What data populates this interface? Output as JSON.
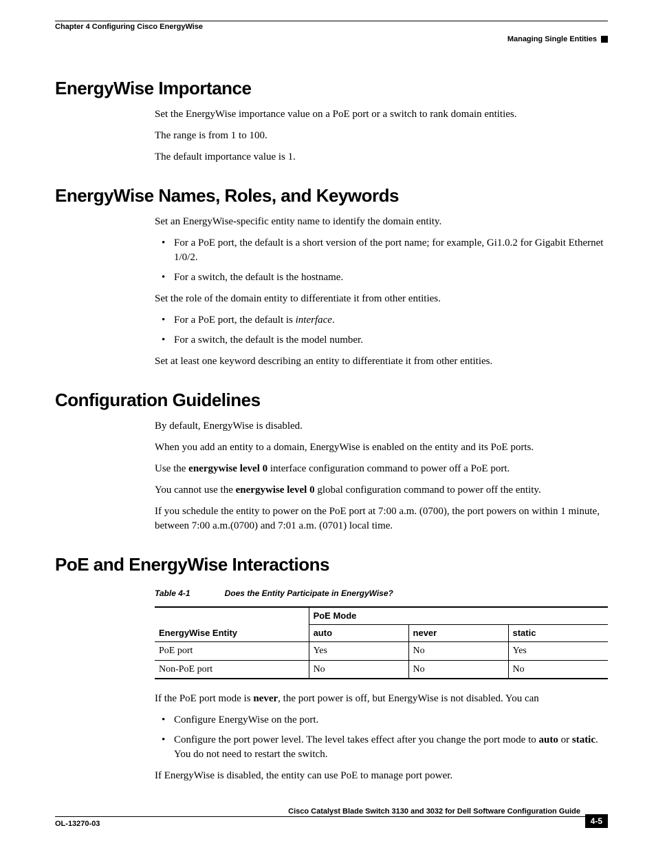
{
  "header": {
    "chapter": "Chapter 4    Configuring Cisco EnergyWise",
    "section_right": "Managing Single Entities"
  },
  "s1": {
    "title": "EnergyWise Importance",
    "p1": "Set the EnergyWise importance value on a PoE port or a switch to rank domain entities.",
    "p2": "The range is from 1 to 100.",
    "p3": "The default importance value is 1."
  },
  "s2": {
    "title": "EnergyWise Names, Roles, and Keywords",
    "p1": "Set an EnergyWise-specific entity name to identify the domain entity.",
    "b1": "For a PoE port, the default is a short version of the port name; for example, Gi1.0.2 for Gigabit Ethernet 1/0/2.",
    "b2": "For a switch, the default is the hostname.",
    "p2": "Set the role of the domain entity to differentiate it from other entities.",
    "b3_pre": "For a PoE port, the default is ",
    "b3_it": "interface",
    "b3_post": ".",
    "b4": "For a switch, the default is the model number.",
    "p3": "Set at least one keyword describing an entity to differentiate it from other entities."
  },
  "s3": {
    "title": "Configuration Guidelines",
    "p1": "By default, EnergyWise is disabled.",
    "p2": "When you add an entity to a domain, EnergyWise is enabled on the entity and its PoE ports.",
    "p3_a": "Use the ",
    "p3_b": "energywise level 0",
    "p3_c": " interface configuration command to power off a PoE port.",
    "p4_a": "You cannot use the ",
    "p4_b": "energywise level 0",
    "p4_c": " global configuration command to power off the entity.",
    "p5": "If you schedule the entity to power on the PoE port at 7:00 a.m. (0700), the port powers on within 1 minute, between 7:00 a.m.(0700) and 7:01 a.m. (0701) local time."
  },
  "s4": {
    "title": "PoE and EnergyWise Interactions",
    "table_num": "Table 4-1",
    "table_title": "Does the Entity Participate in EnergyWise?",
    "th_entity": "EnergyWise Entity",
    "th_mode": "PoE Mode",
    "th_auto": "auto",
    "th_never": "never",
    "th_static": "static",
    "r1c1": "PoE port",
    "r1c2": "Yes",
    "r1c3": "No",
    "r1c4": "Yes",
    "r2c1": "Non-PoE port",
    "r2c2": "No",
    "r2c3": "No",
    "r2c4": "No",
    "p1_a": "If the PoE port mode is ",
    "p1_b": "never",
    "p1_c": ", the port power is off, but EnergyWise is not disabled. You can",
    "b1": "Configure EnergyWise on the port.",
    "b2_a": "Configure the port power level. The level takes effect after you change the port mode to ",
    "b2_b": "auto",
    "b2_c": " or ",
    "b2_d": "static",
    "b2_e": ". You do not need to restart the switch.",
    "p2": "If EnergyWise is disabled, the entity can use PoE to manage port power."
  },
  "footer": {
    "guide": "Cisco Catalyst Blade Switch 3130 and 3032 for Dell Software Configuration Guide",
    "doc": "OL-13270-03",
    "page": "4-5"
  }
}
